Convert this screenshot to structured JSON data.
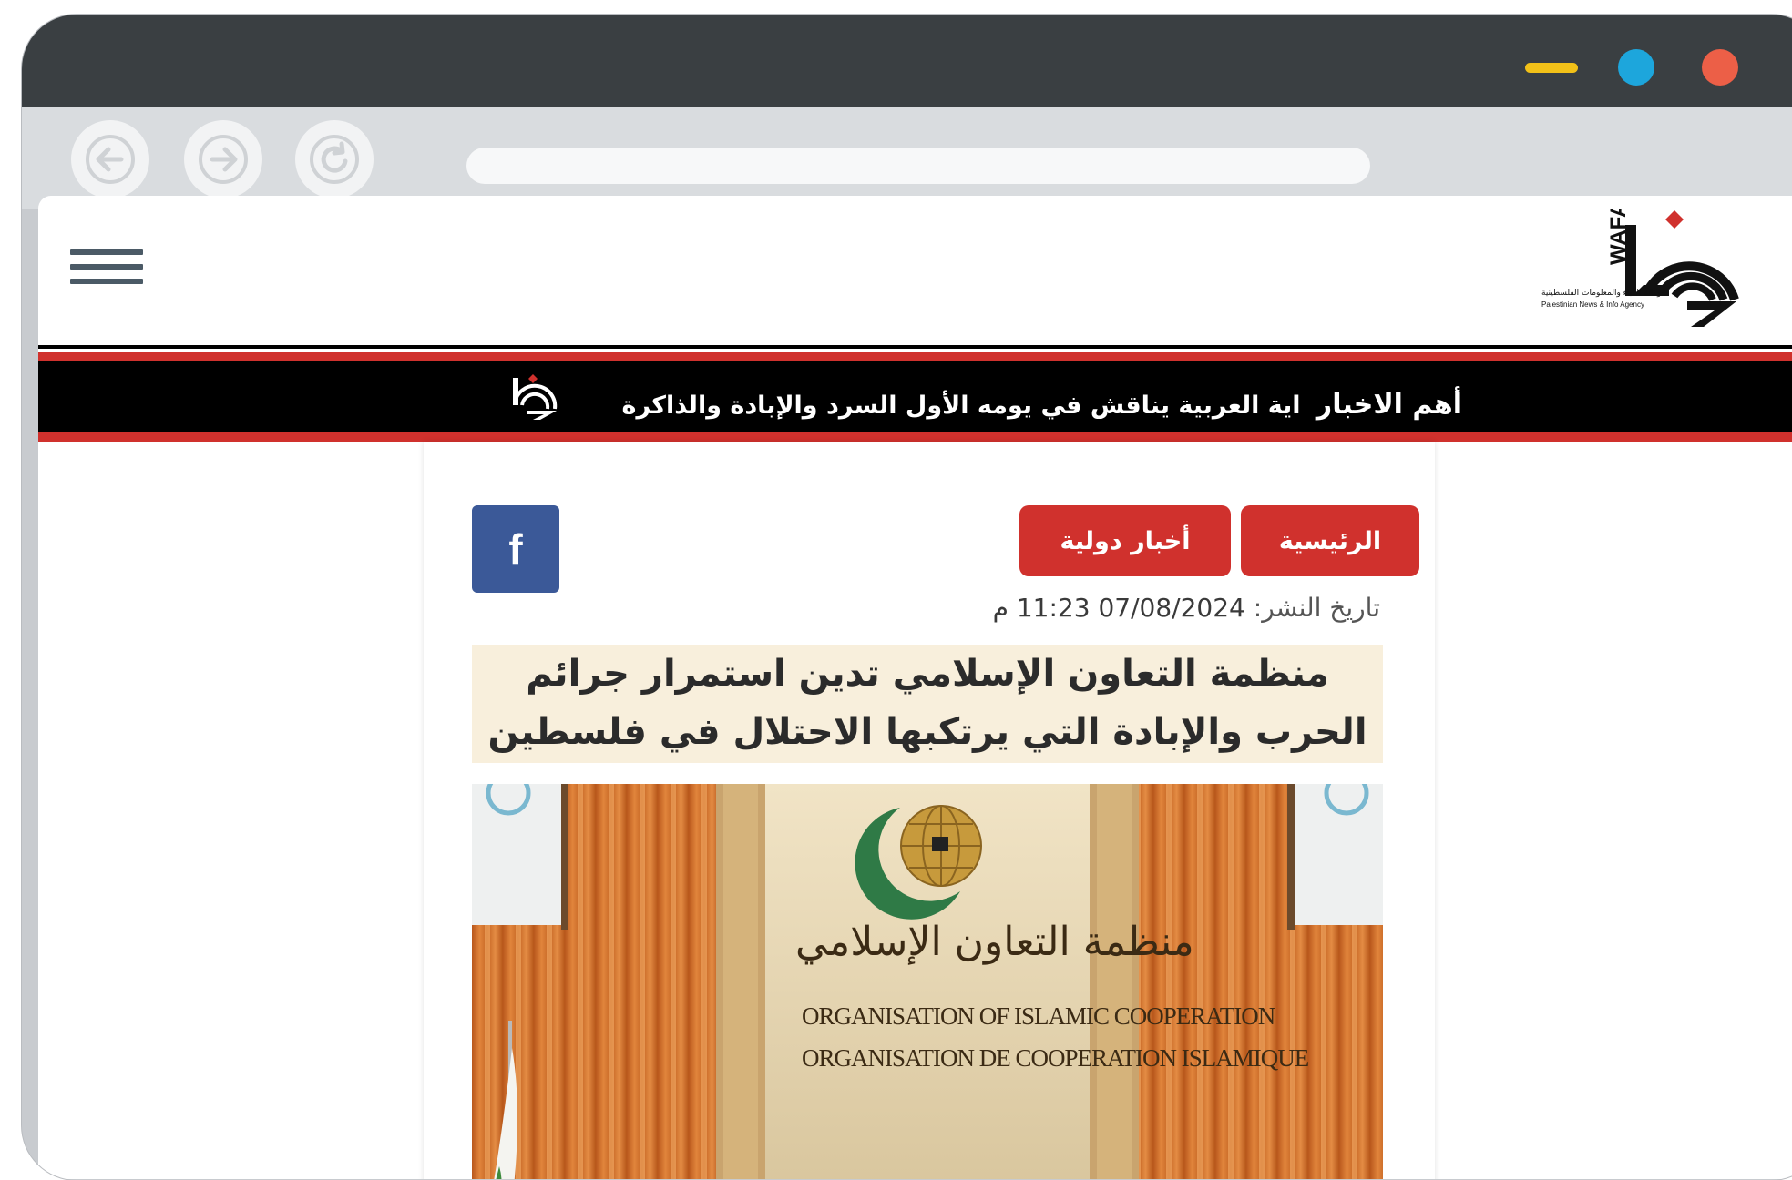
{
  "browser": {
    "window_controls": [
      "minimize",
      "maximize",
      "close"
    ],
    "nav": {
      "back": "back-arrow-icon",
      "forward": "forward-arrow-icon",
      "reload": "reload-icon"
    },
    "address": ""
  },
  "site": {
    "logo_latin": "WAFA",
    "logo_ar": "وكالة الأنباء والمعلومات الفلسطينية",
    "logo_en": "Palestinian News & Info Agency"
  },
  "ticker": {
    "heading": "أهم الاخبار",
    "text": "اية العربية يناقش في يومه الأول السرد والإبادة والذاكرة"
  },
  "article": {
    "breadcrumb": [
      "الرئيسية",
      "أخبار دولية"
    ],
    "share": {
      "facebook": "f"
    },
    "date_label": "تاريخ النشر:",
    "date_value": "07/08/2024 11:23 م",
    "headline": "منظمة التعاون الإسلامي تدين استمرار جرائم الحرب والإبادة التي يرتكبها الاحتلال في فلسطين",
    "image": {
      "name_ar": "منظمة التعاون الإسلامي",
      "name_en": "ORGANISATION OF ISLAMIC COOPERATION",
      "name_fr": "ORGANISATION DE COOPERATION ISLAMIQUE"
    }
  },
  "colors": {
    "accent_red": "#d0312d",
    "facebook_blue": "#3b5998",
    "ticker_bg": "#000000",
    "headline_bg": "#f8efdc",
    "minimize": "#f2c118",
    "maximize": "#1da6dc",
    "close": "#ec5f47"
  }
}
